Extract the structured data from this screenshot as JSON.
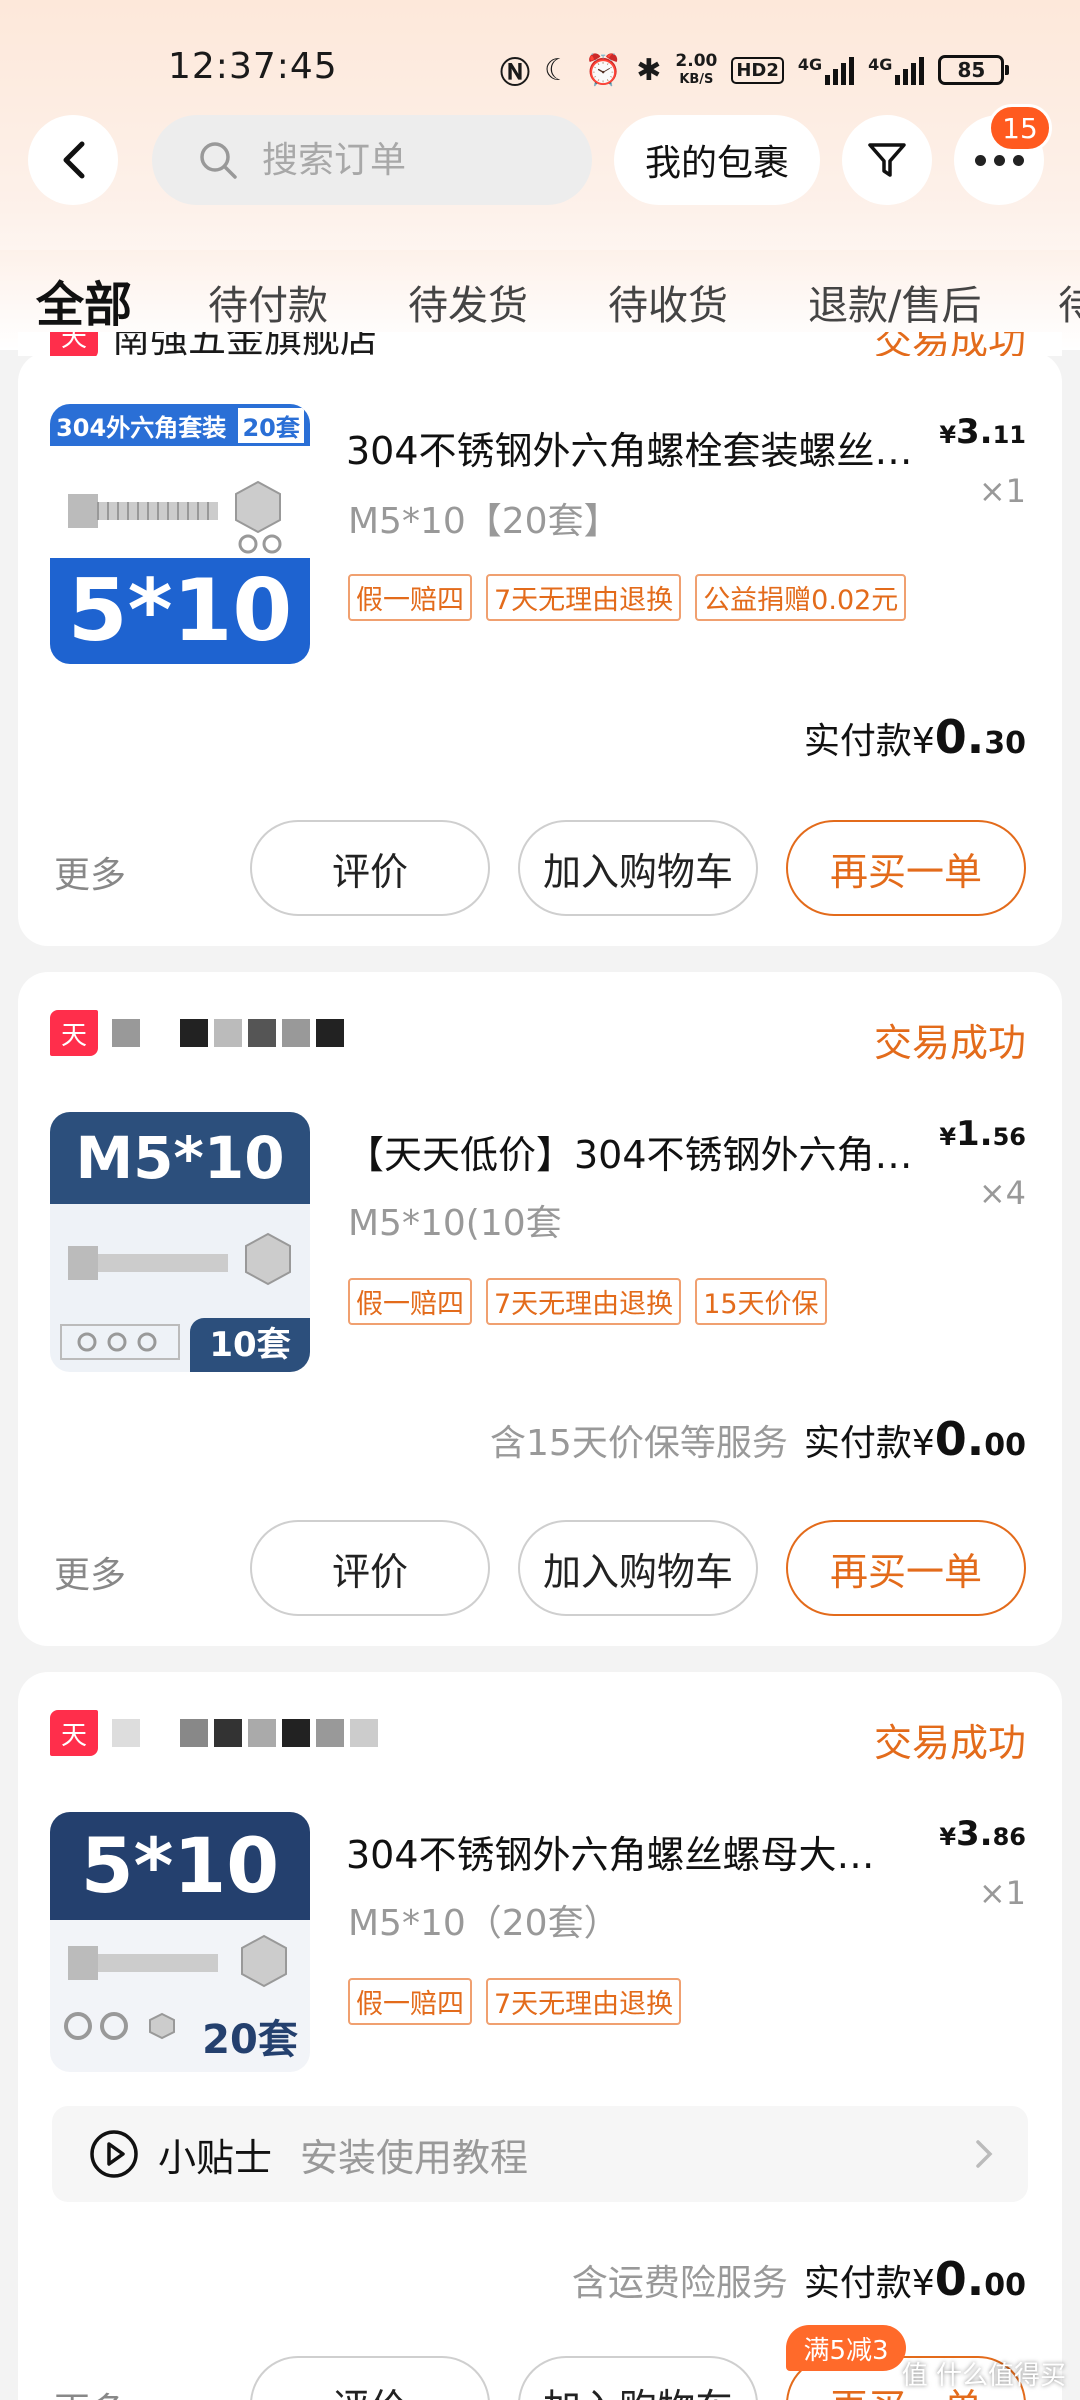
{
  "status_bar": {
    "time": "12:37:45",
    "net_speed": "2.00",
    "net_unit": "KB/S",
    "hd": "HD2",
    "net1": "4G",
    "net2": "4G",
    "battery": "85"
  },
  "header": {
    "search_placeholder": "搜索订单",
    "parcel_button": "我的包裹",
    "badge_count": "15"
  },
  "tabs": [
    "全部",
    "待付款",
    "待发货",
    "待收货",
    "退款/售后",
    "待"
  ],
  "card1": {
    "shop_partial": "南强五金旗舰店",
    "status": "交易成功",
    "thumb_title": "304外六角套装",
    "thumb_count": "20套",
    "thumb_size": "5*10",
    "title": "304不锈钢外六角螺栓套装螺丝…",
    "spec": "M5*10【20套】",
    "price_symbol": "¥",
    "price_int": "3.",
    "price_dec": "11",
    "qty": "×1",
    "tags": [
      "假一赔四",
      "7天无理由退换",
      "公益捐赠0.02元"
    ],
    "paid_label": "实付款",
    "paid_symbol": "¥",
    "paid_int": "0.",
    "paid_dec": "30",
    "more": "更多",
    "btn_review": "评价",
    "btn_cart": "加入购物车",
    "btn_again": "再买一单"
  },
  "card2": {
    "tmall": "天",
    "status": "交易成功",
    "thumb_size": "M5*10",
    "thumb_count": "10套",
    "title": "【天天低价】304不锈钢外六角…",
    "spec": "M5*10(10套",
    "price_symbol": "¥",
    "price_int": "1.",
    "price_dec": "56",
    "qty": "×4",
    "tags": [
      "假一赔四",
      "7天无理由退换",
      "15天价保"
    ],
    "service": "含15天价保等服务",
    "paid_label": "实付款",
    "paid_symbol": "¥",
    "paid_int": "0.",
    "paid_dec": "00",
    "more": "更多",
    "btn_review": "评价",
    "btn_cart": "加入购物车",
    "btn_again": "再买一单"
  },
  "card3": {
    "tmall": "天",
    "status": "交易成功",
    "thumb_size": "5*10",
    "thumb_count": "20套",
    "title": "304不锈钢外六角螺丝螺母大…",
    "spec": "M5*10（20套）",
    "price_symbol": "¥",
    "price_int": "3.",
    "price_dec": "86",
    "qty": "×1",
    "tags": [
      "假一赔四",
      "7天无理由退换"
    ],
    "tips_label": "小贴士",
    "tips_text": "安装使用教程",
    "service": "含运费险服务",
    "paid_label": "实付款",
    "paid_symbol": "¥",
    "paid_int": "0.",
    "paid_dec": "00",
    "promo": "满5减3",
    "more": "更多",
    "btn_review": "评价",
    "btn_cart": "加入购物车",
    "btn_again": "再买一单"
  },
  "watermark": "值 什么值得买",
  "colors": {
    "accent": "#e36b1b",
    "badge": "#ff5a1f",
    "tmall": "#ff2e4b"
  }
}
